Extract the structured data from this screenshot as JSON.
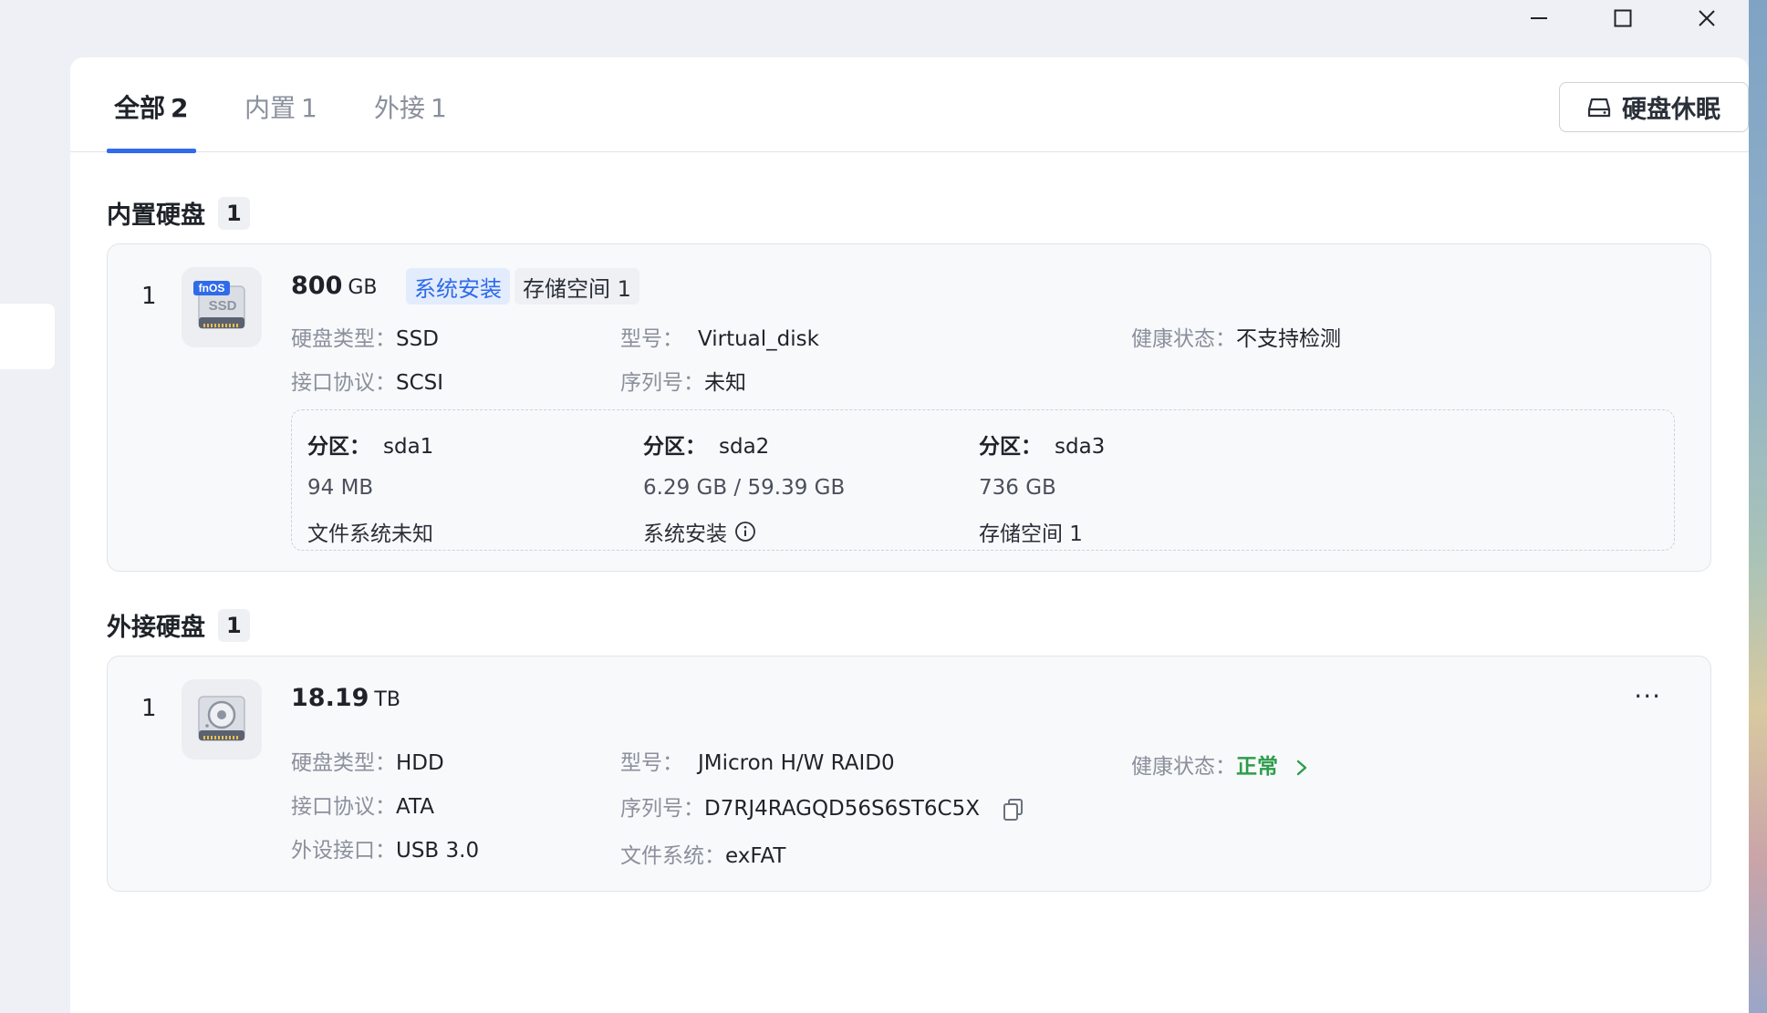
{
  "window": {
    "minimize": "minimize",
    "maximize": "maximize",
    "close": "close"
  },
  "tabs": [
    {
      "label": "全部",
      "count": "2"
    },
    {
      "label": "内置",
      "count": "1"
    },
    {
      "label": "外接",
      "count": "1"
    }
  ],
  "sleep_button": {
    "label": "硬盘休眠"
  },
  "internal": {
    "title": "内置硬盘",
    "count": "1",
    "disk": {
      "index": "1",
      "icon_badge": "fnOS",
      "icon_text": "SSD",
      "capacity": "800",
      "unit": "GB",
      "tags": [
        "系统安装",
        "存储空间 1"
      ],
      "type_label": "硬盘类型：",
      "type_value": "SSD",
      "model_label": "型号：",
      "model_value": "Virtual_disk",
      "health_label": "健康状态：",
      "health_value": "不支持检测",
      "protocol_label": "接口协议：",
      "protocol_value": "SCSI",
      "serial_label": "序列号：",
      "serial_value": "未知",
      "partitions": [
        {
          "label": "分区：",
          "name": "sda1",
          "size": "94 MB",
          "fs": "文件系统未知"
        },
        {
          "label": "分区：",
          "name": "sda2",
          "size": "6.29 GB / 59.39 GB",
          "fs": "系统安装"
        },
        {
          "label": "分区：",
          "name": "sda3",
          "size": "736 GB",
          "fs": "存储空间 1"
        }
      ]
    }
  },
  "external": {
    "title": "外接硬盘",
    "count": "1",
    "disk": {
      "index": "1",
      "capacity": "18.19",
      "unit": "TB",
      "more": "···",
      "type_label": "硬盘类型：",
      "type_value": "HDD",
      "model_label": "型号：",
      "model_value": "JMicron H/W RAID0",
      "health_label": "健康状态：",
      "health_value": "正常",
      "protocol_label": "接口协议：",
      "protocol_value": "ATA",
      "serial_label": "序列号：",
      "serial_value": "D7RJ4RAGQD56S6ST6C5X",
      "port_label": "外设接口：",
      "port_value": "USB 3.0",
      "fs_label": "文件系统：",
      "fs_value": "exFAT"
    }
  },
  "colors": {
    "accent": "#2f6bea",
    "ok": "#2e9d4b",
    "panel": "#ffffff",
    "background": "#eef0f5"
  }
}
